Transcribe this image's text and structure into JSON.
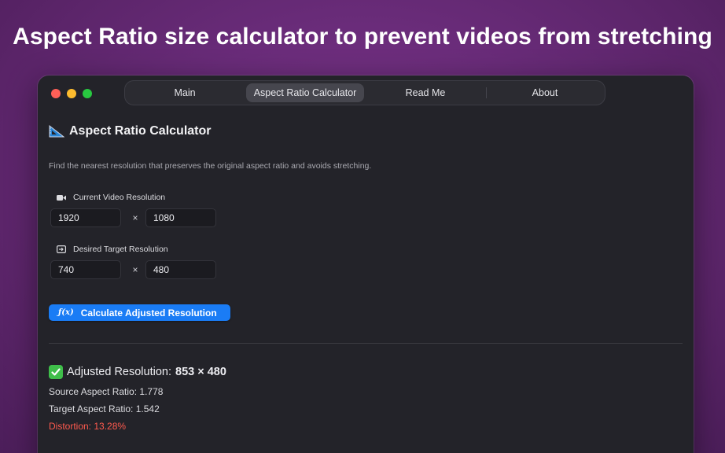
{
  "headline": "Aspect Ratio size calculator to prevent videos from stretching",
  "tabs": [
    {
      "label": "Main"
    },
    {
      "label": "Aspect Ratio Calculator"
    },
    {
      "label": "Read Me"
    },
    {
      "label": "About"
    }
  ],
  "page": {
    "title": "Aspect Ratio Calculator",
    "description": "Find the nearest resolution that preserves the original aspect ratio and avoids stretching."
  },
  "current": {
    "label": "Current Video Resolution",
    "width": "1920",
    "height": "1080"
  },
  "target": {
    "label": "Desired Target Resolution",
    "width": "740",
    "height": "480"
  },
  "times_symbol": "×",
  "button": {
    "icon": "ƒ(x)",
    "label": "Calculate Adjusted Resolution"
  },
  "result": {
    "label": "Adjusted Resolution:",
    "value": "853 × 480",
    "source_ratio": "Source Aspect Ratio: 1.778",
    "target_ratio": "Target Aspect Ratio: 1.542",
    "distortion": "Distortion: 13.28%"
  },
  "icons": {
    "title": "triangular-ruler-icon",
    "current": "video-camera-icon",
    "target": "display-arrow-icon",
    "button": "function-icon",
    "result": "check-mark-icon"
  },
  "colors": {
    "accent": "#1a7cf5",
    "success": "#3fbe4a",
    "warning": "#ff5a4e"
  }
}
